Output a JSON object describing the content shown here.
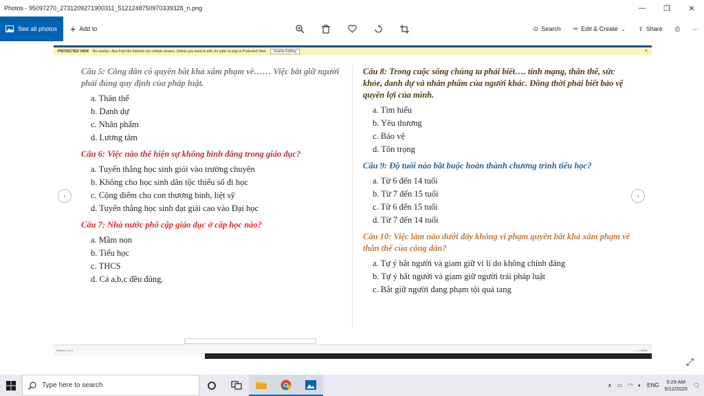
{
  "window": {
    "title": "Photos - 95097270_2731209271900311_5121248750970339328_n.png",
    "controls": {
      "minimize": "—",
      "maximize": "❐",
      "close": "✕"
    }
  },
  "toolbar": {
    "see_all": "See all photos",
    "add_to": "Add to",
    "search": "Search",
    "edit_create": "Edit & Create",
    "share": "Share",
    "more": "···",
    "icons": [
      "zoom-icon",
      "delete-icon",
      "favorite-icon",
      "rotate-icon",
      "crop-icon"
    ]
  },
  "protected_view": {
    "label": "PROTECTED VIEW",
    "message": "Be careful—files from the Internet can contain viruses. Unless you need to edit, it's safer to stay in Protected View.",
    "button": "Enable Editing",
    "close": "×"
  },
  "document": {
    "left": [
      {
        "question": "Câu 5: Công dân có quyền bất khả xâm phạm về…… Việc bắt giữ người phải đúng quy định của pháp luật.",
        "color": "#7a7a7a",
        "options": [
          "a. Thân thể",
          "b. Danh dự",
          "c. Nhân phẩm",
          "d. Lương tâm"
        ]
      },
      {
        "question": "Câu 6: Việc nào thể hiện sự không bình đẳng trong giáo dục?",
        "color": "#b4333a",
        "options": [
          "a. Tuyển thẳng học sinh giỏi vào trường chuyên",
          "b. Không cho học sinh dân tộc thiểu số đi học",
          "c. Cộng điểm cho con thương binh, liệt sỹ",
          "d. Tuyển thẳng học sinh đạt giải cao vào Đại học"
        ]
      },
      {
        "question": "Câu 7: Nhà nước phổ cập giáo dục ở cấp học nào?",
        "color": "#e0282e",
        "options": [
          "a. Mầm non",
          "b. Tiểu học",
          "c. THCS",
          "d. Cả a,b,c đều đúng."
        ]
      }
    ],
    "right": [
      {
        "question": "Câu 8: Trong cuộc sống chúng ta phải biết…. tính mạng, thân thể, sức khỏe, danh dự và nhân phẩm của người khác. Đồng thời phải biết bảo vệ quyền lợi của mình.",
        "color": "#4d3b12",
        "options": [
          "a. Tìm hiểu",
          "b. Yêu thương",
          "c. Bảo vệ",
          "d. Tôn trọng"
        ]
      },
      {
        "question": "Câu 9: Độ tuổi nào bắt buộc hoàn thành chương trình tiểu học?",
        "color": "#2e5f86",
        "options": [
          "a. Từ 6 đến 14 tuổi",
          "b. Từ 7 đến 15 tuổi",
          "c. Từ 6 đến 15 tuổi",
          "d. Từ 7 đến 14 tuổi"
        ]
      },
      {
        "question": "Câu 10: Việc làm nào dưới đây không vi phạm quyền bất khả xâm phạm về thân thể của công dân?",
        "color": "#c07a3a",
        "options": [
          "a. Tự ý bắt người và giam giữ vì lí do không chính đáng",
          "b. Tự ý bắt người và giam giữ người trái pháp luật",
          "c. Bắt giữ người đang phạm tội quả tang"
        ]
      }
    ]
  },
  "nav": {
    "prev": "‹",
    "next": "›"
  },
  "status_bar": {
    "page": "Screen 1 of 3",
    "zoom": "— + 160%"
  },
  "taskbar": {
    "search_placeholder": "Type here to search",
    "apps": [
      "cortana-icon",
      "task-view-icon",
      "file-explorer-icon",
      "chrome-icon",
      "photos-icon"
    ],
    "tray": {
      "lang": "ENG",
      "time": "5:29 AM",
      "date": "5/12/2020"
    }
  }
}
